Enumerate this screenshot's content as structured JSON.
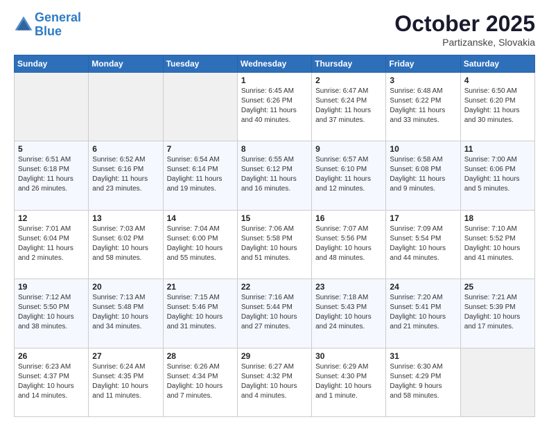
{
  "header": {
    "logo_line1": "General",
    "logo_line2": "Blue",
    "month": "October 2025",
    "location": "Partizanske, Slovakia"
  },
  "weekdays": [
    "Sunday",
    "Monday",
    "Tuesday",
    "Wednesday",
    "Thursday",
    "Friday",
    "Saturday"
  ],
  "weeks": [
    [
      {
        "day": "",
        "info": ""
      },
      {
        "day": "",
        "info": ""
      },
      {
        "day": "",
        "info": ""
      },
      {
        "day": "1",
        "info": "Sunrise: 6:45 AM\nSunset: 6:26 PM\nDaylight: 11 hours\nand 40 minutes."
      },
      {
        "day": "2",
        "info": "Sunrise: 6:47 AM\nSunset: 6:24 PM\nDaylight: 11 hours\nand 37 minutes."
      },
      {
        "day": "3",
        "info": "Sunrise: 6:48 AM\nSunset: 6:22 PM\nDaylight: 11 hours\nand 33 minutes."
      },
      {
        "day": "4",
        "info": "Sunrise: 6:50 AM\nSunset: 6:20 PM\nDaylight: 11 hours\nand 30 minutes."
      }
    ],
    [
      {
        "day": "5",
        "info": "Sunrise: 6:51 AM\nSunset: 6:18 PM\nDaylight: 11 hours\nand 26 minutes."
      },
      {
        "day": "6",
        "info": "Sunrise: 6:52 AM\nSunset: 6:16 PM\nDaylight: 11 hours\nand 23 minutes."
      },
      {
        "day": "7",
        "info": "Sunrise: 6:54 AM\nSunset: 6:14 PM\nDaylight: 11 hours\nand 19 minutes."
      },
      {
        "day": "8",
        "info": "Sunrise: 6:55 AM\nSunset: 6:12 PM\nDaylight: 11 hours\nand 16 minutes."
      },
      {
        "day": "9",
        "info": "Sunrise: 6:57 AM\nSunset: 6:10 PM\nDaylight: 11 hours\nand 12 minutes."
      },
      {
        "day": "10",
        "info": "Sunrise: 6:58 AM\nSunset: 6:08 PM\nDaylight: 11 hours\nand 9 minutes."
      },
      {
        "day": "11",
        "info": "Sunrise: 7:00 AM\nSunset: 6:06 PM\nDaylight: 11 hours\nand 5 minutes."
      }
    ],
    [
      {
        "day": "12",
        "info": "Sunrise: 7:01 AM\nSunset: 6:04 PM\nDaylight: 11 hours\nand 2 minutes."
      },
      {
        "day": "13",
        "info": "Sunrise: 7:03 AM\nSunset: 6:02 PM\nDaylight: 10 hours\nand 58 minutes."
      },
      {
        "day": "14",
        "info": "Sunrise: 7:04 AM\nSunset: 6:00 PM\nDaylight: 10 hours\nand 55 minutes."
      },
      {
        "day": "15",
        "info": "Sunrise: 7:06 AM\nSunset: 5:58 PM\nDaylight: 10 hours\nand 51 minutes."
      },
      {
        "day": "16",
        "info": "Sunrise: 7:07 AM\nSunset: 5:56 PM\nDaylight: 10 hours\nand 48 minutes."
      },
      {
        "day": "17",
        "info": "Sunrise: 7:09 AM\nSunset: 5:54 PM\nDaylight: 10 hours\nand 44 minutes."
      },
      {
        "day": "18",
        "info": "Sunrise: 7:10 AM\nSunset: 5:52 PM\nDaylight: 10 hours\nand 41 minutes."
      }
    ],
    [
      {
        "day": "19",
        "info": "Sunrise: 7:12 AM\nSunset: 5:50 PM\nDaylight: 10 hours\nand 38 minutes."
      },
      {
        "day": "20",
        "info": "Sunrise: 7:13 AM\nSunset: 5:48 PM\nDaylight: 10 hours\nand 34 minutes."
      },
      {
        "day": "21",
        "info": "Sunrise: 7:15 AM\nSunset: 5:46 PM\nDaylight: 10 hours\nand 31 minutes."
      },
      {
        "day": "22",
        "info": "Sunrise: 7:16 AM\nSunset: 5:44 PM\nDaylight: 10 hours\nand 27 minutes."
      },
      {
        "day": "23",
        "info": "Sunrise: 7:18 AM\nSunset: 5:43 PM\nDaylight: 10 hours\nand 24 minutes."
      },
      {
        "day": "24",
        "info": "Sunrise: 7:20 AM\nSunset: 5:41 PM\nDaylight: 10 hours\nand 21 minutes."
      },
      {
        "day": "25",
        "info": "Sunrise: 7:21 AM\nSunset: 5:39 PM\nDaylight: 10 hours\nand 17 minutes."
      }
    ],
    [
      {
        "day": "26",
        "info": "Sunrise: 6:23 AM\nSunset: 4:37 PM\nDaylight: 10 hours\nand 14 minutes."
      },
      {
        "day": "27",
        "info": "Sunrise: 6:24 AM\nSunset: 4:35 PM\nDaylight: 10 hours\nand 11 minutes."
      },
      {
        "day": "28",
        "info": "Sunrise: 6:26 AM\nSunset: 4:34 PM\nDaylight: 10 hours\nand 7 minutes."
      },
      {
        "day": "29",
        "info": "Sunrise: 6:27 AM\nSunset: 4:32 PM\nDaylight: 10 hours\nand 4 minutes."
      },
      {
        "day": "30",
        "info": "Sunrise: 6:29 AM\nSunset: 4:30 PM\nDaylight: 10 hours\nand 1 minute."
      },
      {
        "day": "31",
        "info": "Sunrise: 6:30 AM\nSunset: 4:29 PM\nDaylight: 9 hours\nand 58 minutes."
      },
      {
        "day": "",
        "info": ""
      }
    ]
  ]
}
